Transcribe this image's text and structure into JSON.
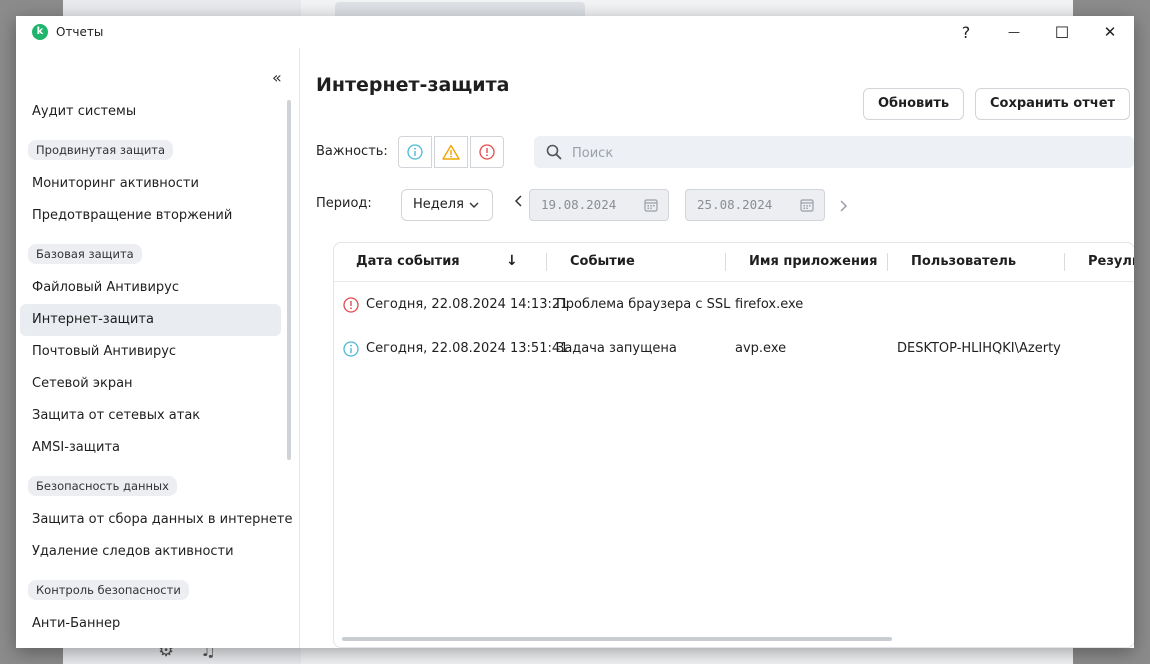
{
  "window": {
    "title": "Отчеты",
    "logo_letter": "k",
    "help_glyph": "?",
    "minimize_glyph": "—",
    "maximize_glyph": "☐",
    "close_glyph": "✕"
  },
  "sidebar": {
    "collapse_glyph": "«",
    "top_items": [
      "Аудит системы"
    ],
    "groups": [
      {
        "title": "Продвинутая защита",
        "items": [
          "Мониторинг активности",
          "Предотвращение вторжений"
        ]
      },
      {
        "title": "Базовая защита",
        "items": [
          "Файловый Антивирус",
          "Интернет-защита",
          "Почтовый Антивирус",
          "Сетевой экран",
          "Защита от сетевых атак",
          "AMSI-защита"
        ]
      },
      {
        "title": "Безопасность данных",
        "items": [
          "Защита от сбора данных в интернете",
          "Удаление следов активности"
        ]
      },
      {
        "title": "Контроль безопасности",
        "items": [
          "Анти-Баннер"
        ]
      }
    ],
    "active_item": "Интернет-защита"
  },
  "main": {
    "title": "Интернет-защита",
    "refresh_label": "Обновить",
    "save_label": "Сохранить отчет",
    "severity_label": "Важность:",
    "search_placeholder": "Поиск",
    "period_label": "Период:",
    "period_value": "Неделя",
    "date_from": "19.08.2024",
    "date_to": "25.08.2024",
    "table": {
      "columns": [
        "Дата события",
        "Событие",
        "Имя приложения",
        "Пользователь",
        "Резуль"
      ],
      "sort_glyph": "↓",
      "rows": [
        {
          "severity": "error",
          "date": "Сегодня, 22.08.2024 14:13:21",
          "event": "Проблема браузера с SSL",
          "app": "firefox.exe",
          "user": ""
        },
        {
          "severity": "info",
          "date": "Сегодня, 22.08.2024 13:51:41",
          "event": "Задача запущена",
          "app": "avp.exe",
          "user": "DESKTOP-HLIHQKI\\Azerty"
        }
      ]
    }
  },
  "colors": {
    "info": "#4bb8d6",
    "warning": "#f0a500",
    "error": "#e24b4b",
    "brand": "#1fb56c"
  },
  "icons": {
    "logo": "kaspersky-logo-icon",
    "search": "search-icon",
    "calendar": "calendar-icon",
    "info": "info-icon",
    "warning": "warning-icon",
    "error": "error-icon"
  }
}
